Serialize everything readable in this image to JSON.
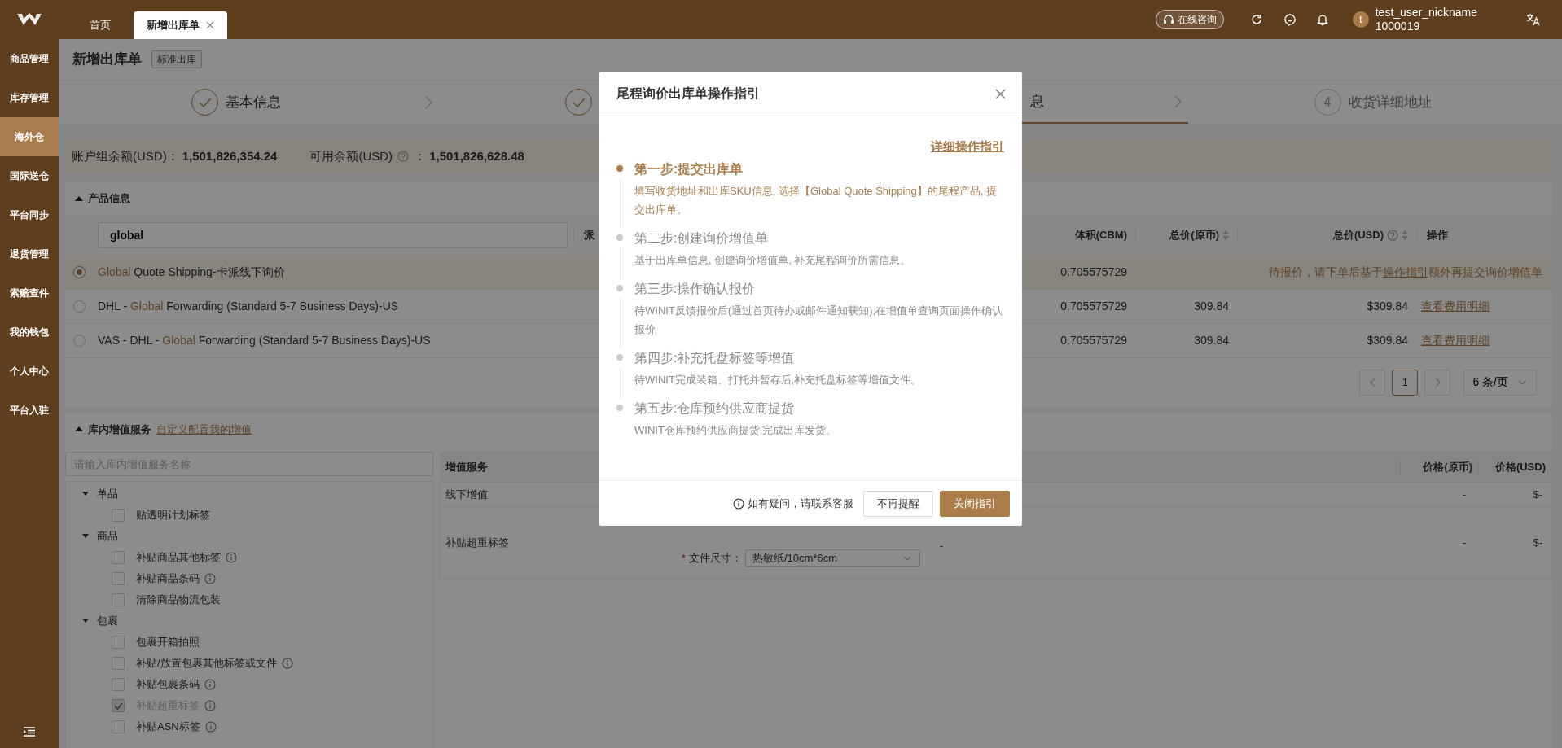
{
  "top_bar": {
    "tabs": [
      {
        "label": "首页",
        "selected": false,
        "closable": false
      },
      {
        "label": "新增出库单",
        "selected": true,
        "closable": true
      }
    ],
    "consult": "在线咨询",
    "user": {
      "avatar": "t",
      "name": "test_user_nickname",
      "id": "1000019"
    }
  },
  "sidebar": {
    "items": [
      {
        "label": "商品管理",
        "selected": false
      },
      {
        "label": "库存管理",
        "selected": false
      },
      {
        "label": "海外仓",
        "selected": true
      },
      {
        "label": "国际送仓",
        "selected": false
      },
      {
        "label": "平台同步",
        "selected": false
      },
      {
        "label": "退货管理",
        "selected": false
      },
      {
        "label": "索赔查件",
        "selected": false
      },
      {
        "label": "我的钱包",
        "selected": false
      },
      {
        "label": "个人中心",
        "selected": false
      },
      {
        "label": "平台入驻",
        "selected": false
      }
    ]
  },
  "page": {
    "title": "新增出库单",
    "tag": "标准出库"
  },
  "steps": [
    {
      "done": true,
      "current": false,
      "label": "基本信息"
    },
    {
      "done": true,
      "current": false
    },
    {
      "done": false,
      "current": true,
      "label": "息"
    },
    {
      "done": false,
      "current": false,
      "number": "4",
      "label": "收货详细地址"
    }
  ],
  "balance": {
    "group_label": "账户组余额(USD)：",
    "group_value": "1,501,826,354.24",
    "available_label": "可用余额(USD)",
    "available_colon": "：",
    "available_value": "1,501,826,628.48"
  },
  "products": {
    "title": "产品信息",
    "expanded": true,
    "search": "global",
    "columns": [
      {
        "label": "派",
        "sortable": false,
        "help": false
      },
      {
        "label": "体积(CBM)",
        "sortable": false,
        "help": false
      },
      {
        "label": "总价(原币)",
        "sortable": true,
        "help": false
      },
      {
        "label": "总价(USD)",
        "sortable": true,
        "help": true
      },
      {
        "label": "操作",
        "sortable": false,
        "help": false
      }
    ],
    "rows": [
      {
        "selected": true,
        "name": [
          {
            "text": "Global",
            "match": true
          },
          {
            "text": " Quote Shipping-卡派线下询价",
            "match": false
          }
        ],
        "volume": "0.705575729",
        "note": "待报价，请下单后基于",
        "note_link": "操作指引",
        "note_after": "额外再提交询价增值单"
      },
      {
        "selected": false,
        "name": [
          {
            "text": "DHL - ",
            "match": false
          },
          {
            "text": "Global",
            "match": true
          },
          {
            "text": " Forwarding (Standard 5-7 Business Days)-US",
            "match": false
          }
        ],
        "volume": "0.705575729",
        "price": "309.84",
        "price_usd": "$309.84",
        "action": "查看费用明细"
      },
      {
        "selected": false,
        "name": [
          {
            "text": "VAS - DHL - ",
            "match": false
          },
          {
            "text": "Global",
            "match": true
          },
          {
            "text": " Forwarding (Standard 5-7 Business Days)-US",
            "match": false
          }
        ],
        "volume": "0.705575729",
        "price": "309.84",
        "price_usd": "$309.84",
        "action": "查看费用明细"
      }
    ],
    "pagination": {
      "page": "1",
      "page_size": "6 条/页"
    }
  },
  "services": {
    "title": "库内增值服务",
    "expanded": true,
    "link": "自定义配置我的增值",
    "search_placeholder": "请输入库内增值服务名称",
    "tree": [
      {
        "label": "单品",
        "expanded": true,
        "children": [
          {
            "label": "贴透明计划标签",
            "checked": false,
            "disabled": false,
            "info": false
          }
        ]
      },
      {
        "label": "商品",
        "expanded": true,
        "children": [
          {
            "label": "补贴商品其他标签",
            "checked": false,
            "disabled": false,
            "info": true
          },
          {
            "label": "补贴商品条码",
            "checked": false,
            "disabled": false,
            "info": true
          },
          {
            "label": "清除商品物流包装",
            "checked": false,
            "disabled": false,
            "info": false
          }
        ]
      },
      {
        "label": "包裹",
        "expanded": true,
        "children": [
          {
            "label": "包裹开箱拍照",
            "checked": false,
            "disabled": false,
            "info": false
          },
          {
            "label": "补贴/放置包裹其他标签或文件",
            "checked": false,
            "disabled": false,
            "info": true
          },
          {
            "label": "补贴包裹条码",
            "checked": false,
            "disabled": false,
            "info": true
          },
          {
            "label": "补贴超重标签",
            "checked": true,
            "disabled": true,
            "info": true
          },
          {
            "label": "补贴ASN标签",
            "checked": false,
            "disabled": false,
            "info": true
          }
        ]
      }
    ],
    "table": {
      "columns": [
        "增值服务",
        "价格(原币)",
        "价格(USD)"
      ],
      "rows": [
        {
          "name": "线下增值",
          "price": "-",
          "price_usd": "$-"
        },
        {
          "name": "补贴超重标签",
          "fields": [
            {
              "label": "文件尺寸：",
              "required_mark": "*",
              "value": "热敏纸/10cm*6cm"
            }
          ],
          "detail": "-",
          "price": "-",
          "price_usd": "$-"
        }
      ]
    }
  },
  "modal": {
    "title": "尾程询价出库单操作指引",
    "link": "详细操作指引",
    "steps": [
      {
        "title": "第一步:提交出库单",
        "desc": "填写收货地址和出库SKU信息, 选择【Global Quote Shipping】的尾程产品, 提交出库单。",
        "active": true
      },
      {
        "title": "第二步:创建询价增值单",
        "desc": "基于出库单信息, 创建询价增值单, 补充尾程询价所需信息。",
        "active": false
      },
      {
        "title": "第三步:操作确认报价",
        "desc": "待WINIT反馈报价后(通过首页待办或邮件通知获知),在增值单查询页面操作确认报价",
        "active": false
      },
      {
        "title": "第四步:补充托盘标签等增值",
        "desc": "待WINIT完成装箱、打托并暂存后,补充托盘标签等增值文件。",
        "active": false
      },
      {
        "title": "第五步:仓库预约供应商提货",
        "desc": "WINIT仓库预约供应商提货,完成出库发货。",
        "active": false
      }
    ],
    "note": "如有疑问，请联系客服",
    "buttons": [
      {
        "label": "不再提醒",
        "kind": "default"
      },
      {
        "label": "关闭指引",
        "kind": "primary"
      }
    ]
  }
}
